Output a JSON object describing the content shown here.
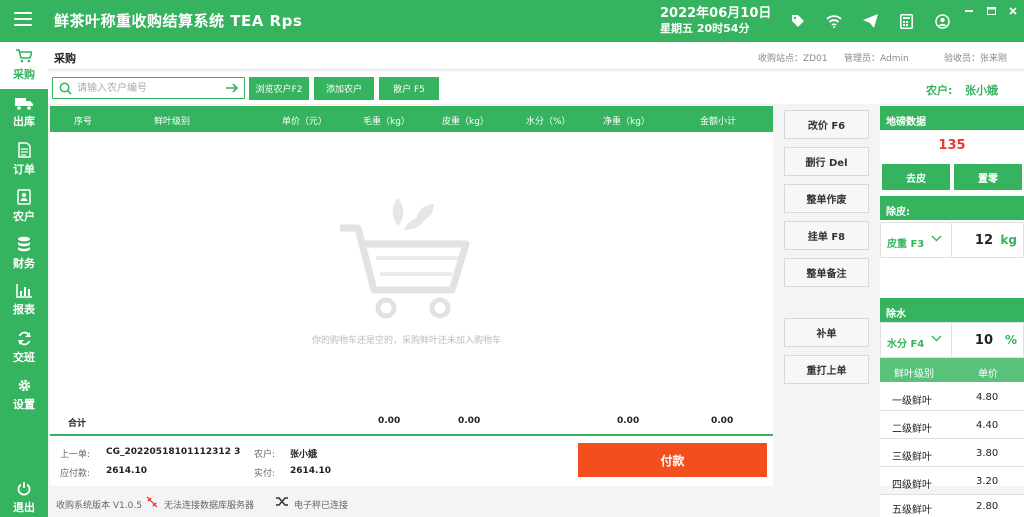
{
  "app": {
    "title": "鲜茶叶称重收购结算系统  TEA  Rps",
    "date": "2022年06月10日",
    "weekday_time": "星期五   20时54分"
  },
  "top_icons": [
    "tag-icon",
    "wifi-icon",
    "send-icon",
    "calculator-icon",
    "user-circle-icon"
  ],
  "sidebar": {
    "items": [
      {
        "label": "采购",
        "icon": "cart-icon",
        "active": true
      },
      {
        "label": "出库",
        "icon": "truck-icon"
      },
      {
        "label": "订单",
        "icon": "document-icon"
      },
      {
        "label": "农户",
        "icon": "contact-icon"
      },
      {
        "label": "财务",
        "icon": "database-icon"
      },
      {
        "label": "报表",
        "icon": "bar-chart-icon"
      },
      {
        "label": "交班",
        "icon": "refresh-icon"
      },
      {
        "label": "设置",
        "icon": "gear-icon"
      }
    ],
    "exit_label": "退出"
  },
  "header": {
    "page_title": "采购",
    "station": "收购站点：ZD01",
    "admin": "管理员：Admin",
    "inspector": "验收员：张来刚"
  },
  "toolbar": {
    "search_placeholder": "请输入农户编号",
    "browse_label": "浏览农户F2",
    "add_label": "添加农户",
    "scatter_label": "散户 F5",
    "farmer_label": "农户:",
    "farmer_name": "张小娥"
  },
  "table": {
    "columns": [
      "序号",
      "鲜叶级别",
      "单价（元）",
      "毛重（kg）",
      "皮重（kg）",
      "水分（%）",
      "净重（kg）",
      "金额小计"
    ],
    "empty_text": "你的购物车还是空的，采购鲜叶还未加入购物车",
    "total_label": "合计",
    "totals": {
      "gross": "0.00",
      "tare": "0.00",
      "net": "0.00",
      "amount": "0.00"
    }
  },
  "footer": {
    "prev_order_label": "上一单:",
    "prev_order": "CG_20220518101112312 3",
    "payable_label": "应付款:",
    "payable": "2614.10",
    "farmer_label": "农户:",
    "farmer": "张小娥",
    "paid_label": "实付:",
    "paid": "2614.10",
    "pay_label": "付款"
  },
  "actions": [
    "改价 F6",
    "删行 Del",
    "整单作废",
    "挂单 F8",
    "整单备注",
    "补单",
    "重打上单"
  ],
  "scale": {
    "title": "地磅数据",
    "weight": "135",
    "tare_btn": "去皮",
    "zero_btn": "置零",
    "tare_section": "除皮:",
    "tare_label": "皮重 F3",
    "tare_value": "12",
    "tare_unit": "kg",
    "water_section": "除水",
    "water_label": "水分 F4",
    "water_value": "10",
    "water_unit": "%",
    "grade_header": "鲜叶级别",
    "price_header": "单价",
    "grades": [
      {
        "name": "一级鲜叶",
        "price": "4.80"
      },
      {
        "name": "二级鲜叶",
        "price": "4.40"
      },
      {
        "name": "三级鲜叶",
        "price": "3.80"
      },
      {
        "name": "四级鲜叶",
        "price": "3.20"
      },
      {
        "name": "五级鲜叶",
        "price": "2.80"
      }
    ]
  },
  "status": {
    "version": "收购系统版本 V1.0.5",
    "db": "无法连接数据库服务器",
    "scale": "电子秤已连接"
  },
  "colors": {
    "primary": "#35b35e",
    "pay": "#f24e1e",
    "weight": "#e53935"
  }
}
